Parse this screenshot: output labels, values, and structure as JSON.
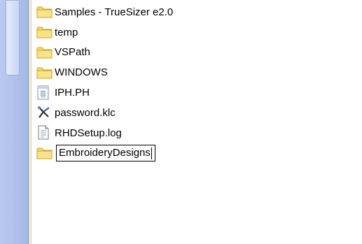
{
  "explorer": {
    "items": [
      {
        "type": "folder",
        "icon": "folder-icon",
        "label": "Samples - TrueSizer e2.0"
      },
      {
        "type": "folder",
        "icon": "folder-icon",
        "label": "temp"
      },
      {
        "type": "folder",
        "icon": "folder-icon",
        "label": "VSPath"
      },
      {
        "type": "folder",
        "icon": "folder-icon",
        "label": "WINDOWS"
      },
      {
        "type": "file",
        "icon": "ph-file-icon",
        "label": "IPH.PH"
      },
      {
        "type": "file",
        "icon": "klc-file-icon",
        "label": "password.klc"
      },
      {
        "type": "file",
        "icon": "log-file-icon",
        "label": "RHDSetup.log"
      }
    ],
    "rename_item": {
      "icon": "folder-icon",
      "value": "EmbroideryDesigns"
    }
  },
  "colors": {
    "folder_fill": "#f6d96b",
    "folder_stroke": "#c9a227",
    "left_pane": "#aebfe9"
  }
}
